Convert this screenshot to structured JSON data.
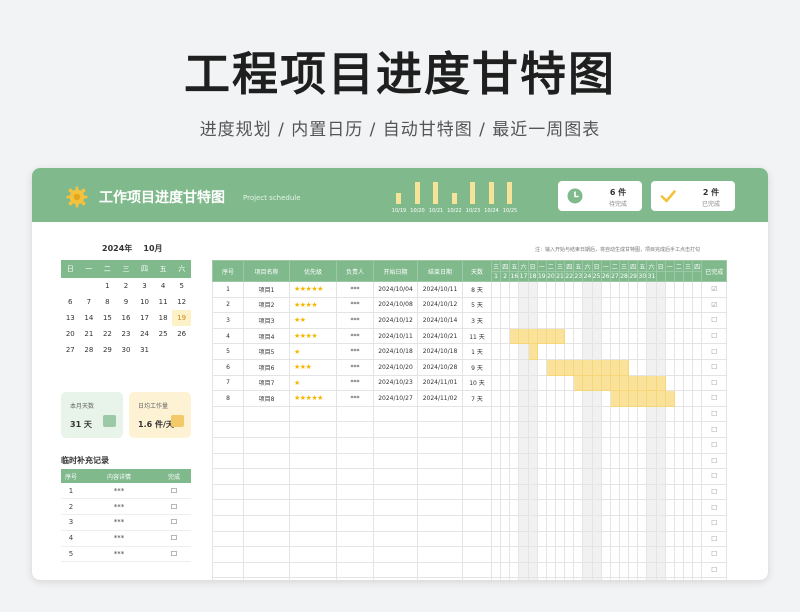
{
  "hero": {
    "title": "工程项目进度甘特图",
    "subtitle": "进度规划 / 内置日历 / 自动甘特图 / 最近一周图表"
  },
  "app": {
    "title": "工作项目进度甘特图",
    "subtitle": "Project schedule",
    "gear_icon": "gear-icon",
    "header_color": "#7fb98c",
    "accent_yellow": "#fbe29a"
  },
  "week_chart": {
    "dates": [
      "10/19",
      "10/20",
      "10/21",
      "10/22",
      "10/23",
      "10/24",
      "10/25"
    ],
    "values": [
      2,
      4,
      4,
      2,
      4,
      4,
      4
    ]
  },
  "stats": {
    "pending": {
      "value": "6 件",
      "label": "待完成",
      "icon": "clock-icon"
    },
    "done": {
      "value": "2 件",
      "label": "已完成",
      "icon": "check-icon"
    }
  },
  "calendar": {
    "year_label": "2024年",
    "month_label": "10月",
    "weekdays": [
      "日",
      "一",
      "二",
      "三",
      "四",
      "五",
      "六"
    ],
    "today": 19,
    "weeks": [
      [
        "",
        "",
        "1",
        "2",
        "3",
        "4",
        "5"
      ],
      [
        "6",
        "7",
        "8",
        "9",
        "10",
        "11",
        "12"
      ],
      [
        "13",
        "14",
        "15",
        "16",
        "17",
        "18",
        "19"
      ],
      [
        "20",
        "21",
        "22",
        "23",
        "24",
        "25",
        "26"
      ],
      [
        "27",
        "28",
        "29",
        "30",
        "31",
        "",
        ""
      ]
    ]
  },
  "kpis": {
    "days": {
      "label": "本月天数",
      "value": "31 天"
    },
    "workload": {
      "label": "日均工作量",
      "value": "1.6 件/天"
    }
  },
  "log": {
    "title": "临时补充记录",
    "headers": [
      "序号",
      "内容详情",
      "完成"
    ],
    "rows": [
      [
        "1",
        "***",
        "☐"
      ],
      [
        "2",
        "***",
        "☐"
      ],
      [
        "3",
        "***",
        "☐"
      ],
      [
        "4",
        "***",
        "☐"
      ],
      [
        "5",
        "***",
        "☐"
      ]
    ]
  },
  "table": {
    "note": "注：输入开始与结束日期后，将自动生成甘特图，项目完成后手工点击打勾",
    "headers": [
      "序号",
      "项目名称",
      "优先级",
      "负责人",
      "开始日期",
      "结束日期",
      "天数"
    ],
    "done_header": "已完成",
    "gantt_weekdays": [
      "三",
      "四",
      "五",
      "六",
      "日",
      "一",
      "二",
      "三",
      "四",
      "五",
      "六",
      "日",
      "一",
      "二",
      "三",
      "四",
      "五",
      "六",
      "日",
      "一",
      "二",
      "三",
      "四"
    ],
    "gantt_days": [
      "1",
      "2",
      "16",
      "17",
      "18",
      "19",
      "20",
      "21",
      "22",
      "23",
      "24",
      "25",
      "26",
      "27",
      "28",
      "29",
      "30",
      "31"
    ],
    "rows": [
      {
        "no": "1",
        "name": "项目1",
        "priority": "★★★★★",
        "owner": "***",
        "start": "2024/10/04",
        "end": "2024/10/11",
        "days": "8 天",
        "done": "☑"
      },
      {
        "no": "2",
        "name": "项目2",
        "priority": "★★★★",
        "owner": "***",
        "start": "2024/10/08",
        "end": "2024/10/12",
        "days": "5 天",
        "done": "☑"
      },
      {
        "no": "3",
        "name": "项目3",
        "priority": "★★",
        "owner": "***",
        "start": "2024/10/12",
        "end": "2024/10/14",
        "days": "3 天",
        "done": "☐"
      },
      {
        "no": "4",
        "name": "项目4",
        "priority": "★★★★",
        "owner": "***",
        "start": "2024/10/11",
        "end": "2024/10/21",
        "days": "11 天",
        "done": "☐"
      },
      {
        "no": "5",
        "name": "项目5",
        "priority": "★",
        "owner": "***",
        "start": "2024/10/18",
        "end": "2024/10/18",
        "days": "1 天",
        "done": "☐"
      },
      {
        "no": "6",
        "name": "项目6",
        "priority": "★★★",
        "owner": "***",
        "start": "2024/10/20",
        "end": "2024/10/28",
        "days": "9 天",
        "done": "☐"
      },
      {
        "no": "7",
        "name": "项目7",
        "priority": "★",
        "owner": "***",
        "start": "2024/10/23",
        "end": "2024/11/01",
        "days": "10 天",
        "done": "☐"
      },
      {
        "no": "8",
        "name": "项目8",
        "priority": "★★★★★",
        "owner": "***",
        "start": "2024/10/27",
        "end": "2024/11/02",
        "days": "7 天",
        "done": "☐"
      }
    ],
    "empty_done_mark": "☐"
  }
}
